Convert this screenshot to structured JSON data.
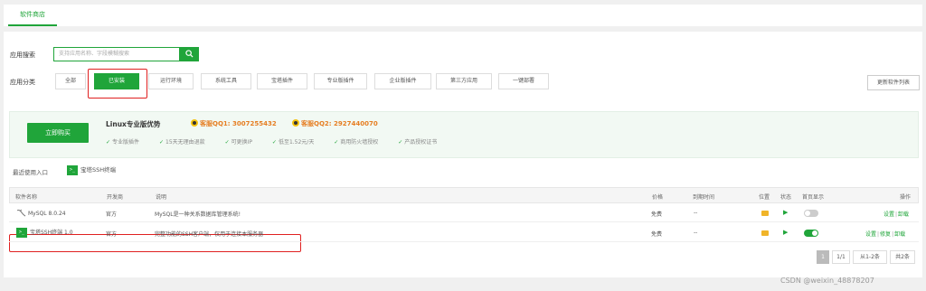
{
  "tabs": {
    "store_label": "软件商店"
  },
  "search": {
    "label": "应用搜索",
    "placeholder": "支持应用名称、字段模糊搜索",
    "icon": "search-icon"
  },
  "categories": {
    "label": "应用分类",
    "items": [
      "全部",
      "已安装",
      "运行环境",
      "系统工具",
      "宝塔插件",
      "专业版插件",
      "企业版插件",
      "第三方应用",
      "一键部署"
    ],
    "active_index": 1,
    "refresh_label": "更新软件列表"
  },
  "promo": {
    "buy_label": "立即购买",
    "title": "Linux专业版优势",
    "qq1": "客服QQ1: 3007255432",
    "qq2": "客服QQ2: 2927440070",
    "features": [
      "专业版插件",
      "15天无理由退款",
      "可更换IP",
      "低至1.52元/天",
      "商用防火墙授权",
      "产品授权证书"
    ]
  },
  "recent": {
    "label": "最近使用入口",
    "item": "宝塔SSH终端"
  },
  "table": {
    "headers": {
      "name": "软件名称",
      "developer": "开发商",
      "description": "说明",
      "price": "价格",
      "expire": "到期时间",
      "location": "位置",
      "status": "状态",
      "home_display": "首页显示",
      "action": "操作"
    },
    "rows": [
      {
        "name": "MySQL 8.0.24",
        "developer": "官方",
        "description": "MySQL是一种关系数据库管理系统!",
        "price": "免费",
        "expire": "--",
        "home_display": false,
        "actions": [
          "设置",
          "卸载"
        ]
      },
      {
        "name": "宝塔SSH终端 1.0",
        "developer": "官方",
        "description": "完整功能的SSH客户端，仅用于连接本服务器",
        "price": "免费",
        "expire": "--",
        "home_display": true,
        "actions": [
          "设置",
          "修复",
          "卸载"
        ]
      }
    ]
  },
  "pagination": {
    "current": "1",
    "pages": "1/1",
    "range": "从1-2条",
    "total": "共2条"
  },
  "watermark": "CSDN @weixin_48878207",
  "colors": {
    "accent": "#20a53a",
    "highlight_box": "#e02020"
  }
}
